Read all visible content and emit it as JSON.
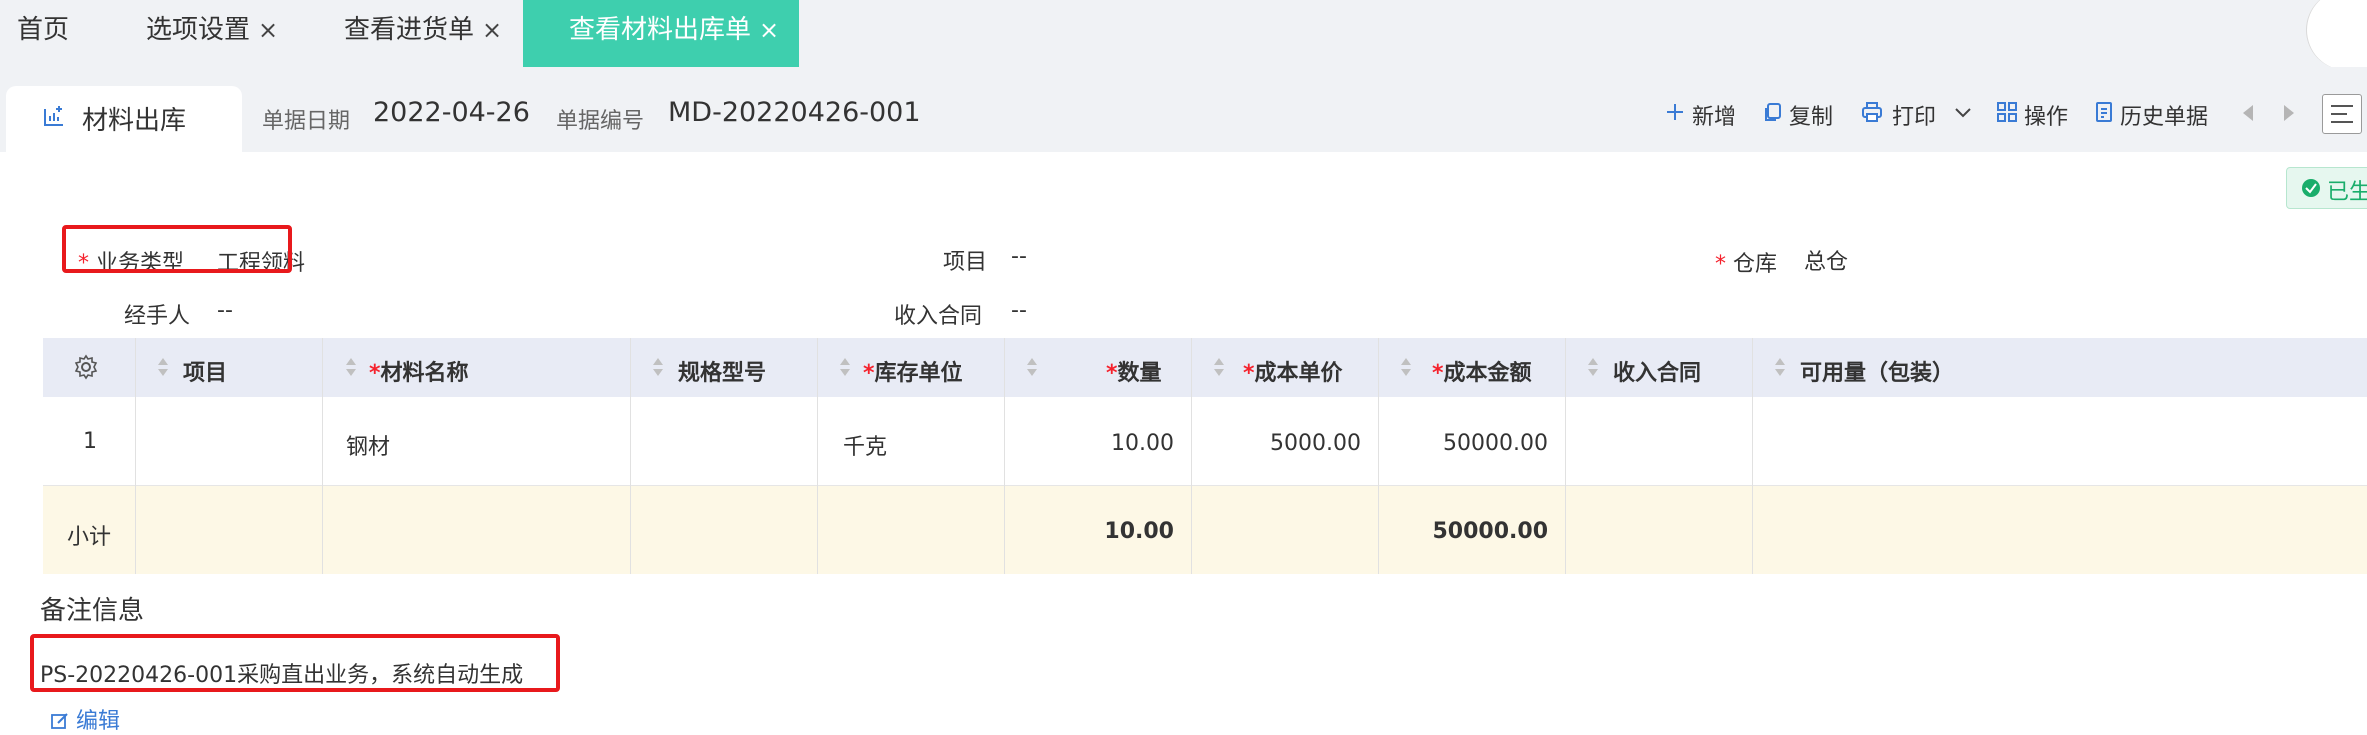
{
  "tabs": [
    {
      "label": "首页",
      "closable": false
    },
    {
      "label": "选项设置",
      "closable": true
    },
    {
      "label": "查看进货单",
      "closable": true
    },
    {
      "label": "查看材料出库单",
      "closable": true,
      "active": true
    }
  ],
  "close_glyph": "×",
  "doc_tab": {
    "label": "材料出库",
    "icon": "chart-icon"
  },
  "meta": {
    "date_label": "单据日期",
    "date_value": "2022-04-26",
    "number_label": "单据编号",
    "number_value": "MD-20220426-001"
  },
  "toolbar": {
    "add": "新增",
    "copy": "复制",
    "print": "打印",
    "operate": "操作",
    "history": "历史单据"
  },
  "status": "已生",
  "required_mark": "*",
  "form": {
    "biz_type_label": "业务类型",
    "biz_type_value": "工程领料",
    "project_label": "项目",
    "project_value": "--",
    "warehouse_label": "仓库",
    "warehouse_value": "总仓",
    "handler_label": "经手人",
    "handler_value": "--",
    "contract_label": "收入合同",
    "contract_value": "--"
  },
  "table": {
    "headers": [
      "项目",
      "材料名称",
      "规格型号",
      "库存单位",
      "数量",
      "成本单价",
      "成本金额",
      "收入合同",
      "可用量（包装）"
    ],
    "row": {
      "index": "1",
      "project": "",
      "material": "钢材",
      "spec": "",
      "unit": "千克",
      "qty": "10.00",
      "unit_cost": "5000.00",
      "amount": "50000.00",
      "contract": "",
      "available": ""
    },
    "subtotal": {
      "label": "小计",
      "qty": "10.00",
      "amount": "50000.00"
    }
  },
  "remarks": {
    "title": "备注信息",
    "text": "PS-20220426-001采购直出业务，系统自动生成",
    "edit": "编辑"
  },
  "colors": {
    "accent": "#3ecfae",
    "required": "#f5222d",
    "highlight": "#e8191c",
    "link": "#3a7bd5",
    "subtotal_bg": "#fdf8e6",
    "header_bg": "#e8ebf5"
  }
}
